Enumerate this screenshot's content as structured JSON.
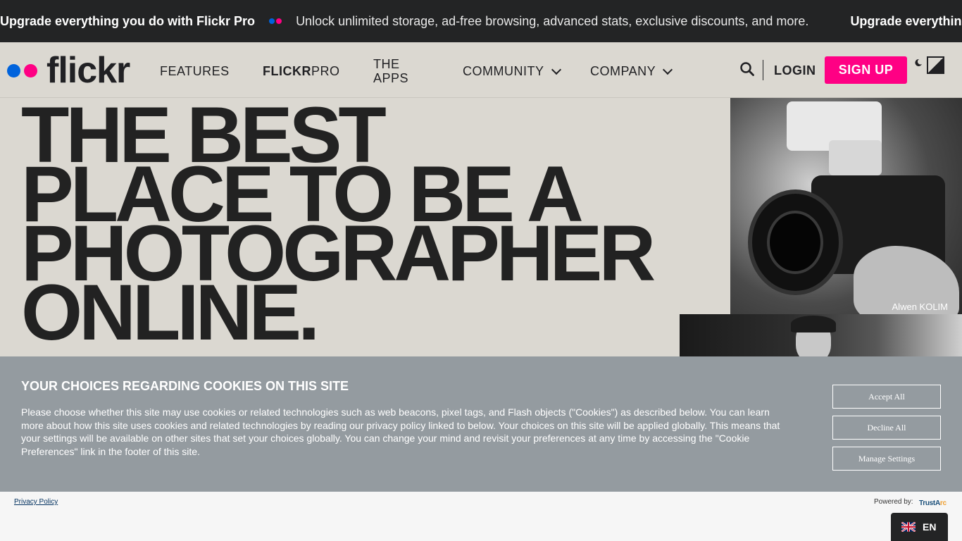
{
  "promo": {
    "title": "Upgrade everything you do with Flickr Pro",
    "message": "Unlock unlimited storage, ad-free browsing, advanced stats, exclusive discounts, and more.",
    "title_repeat": "Upgrade everything you do with Flickr Pro",
    "dot_colors": [
      "#0063dc",
      "#ff0084"
    ]
  },
  "header": {
    "logo_text": "flickr",
    "logo_colors": [
      "#0063dc",
      "#ff0084"
    ],
    "nav": {
      "features": "FEATURES",
      "pro_bold": "FLICKR",
      "pro_rest": "PRO",
      "apps_line1": "THE",
      "apps_line2": "APPS",
      "community": "COMMUNITY",
      "company": "COMPANY"
    },
    "login": "LOGIN",
    "signup": "SIGN UP",
    "signup_color": "#ff0084"
  },
  "hero": {
    "lines": [
      "THE BEST",
      "PLACE TO BE A",
      "PHOTOGRAPHER",
      "ONLINE."
    ],
    "photo_credit": "Alwen KOLIM"
  },
  "cookie": {
    "title": "YOUR CHOICES REGARDING COOKIES ON THIS SITE",
    "body": "Please choose whether this site may use cookies or related technologies such as web beacons, pixel tags, and Flash objects (\"Cookies\") as described below. You can learn more about how this site uses cookies and related technologies by reading our privacy policy linked to below. Your choices on this site will be applied globally. This means that your settings will be available on other sites that set your choices globally. You can change your mind and revisit your preferences at any time by accessing the \"Cookie Preferences\" link in the footer of this site.",
    "accept": "Accept All",
    "decline": "Decline All",
    "manage": "Manage Settings"
  },
  "footer": {
    "privacy": "Privacy Policy",
    "powered_by": "Powered by:",
    "trustarc_a": "TrustA",
    "trustarc_b": "rc"
  },
  "language": {
    "code": "EN",
    "flag_icon": "uk-flag-icon"
  }
}
